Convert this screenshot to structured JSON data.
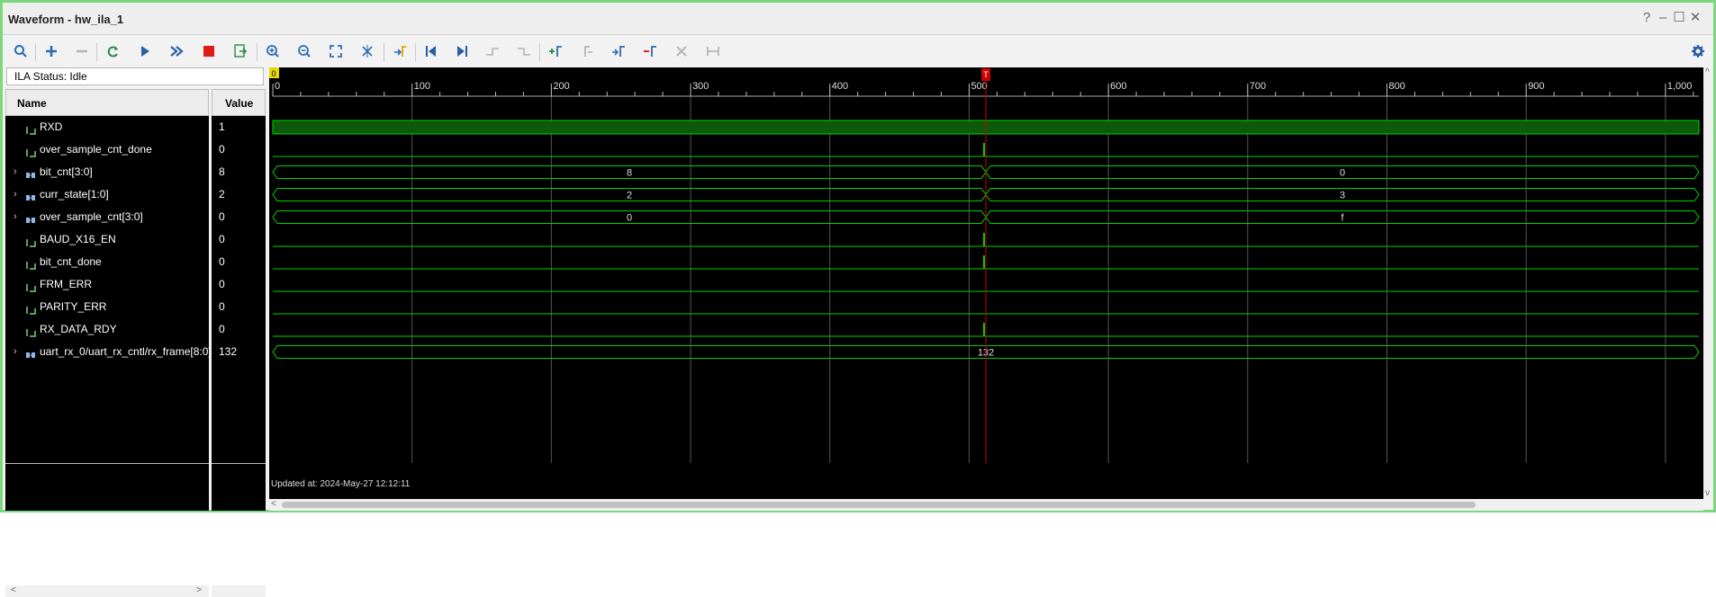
{
  "window": {
    "title": "Waveform - hw_ila_1",
    "controls": [
      "?",
      "–",
      "☐",
      "✕"
    ]
  },
  "toolbar": {
    "buttons": [
      "search-icon",
      "add-icon",
      "remove-icon",
      "refresh-icon",
      "run-trigger-icon",
      "run-immediate-icon",
      "stop-icon",
      "export-icon",
      "zoom-in-icon",
      "zoom-out-icon",
      "zoom-fit-icon",
      "cursor-icon",
      "goto-marker-icon",
      "goto-first-icon",
      "goto-last-icon",
      "prev-transition-icon",
      "next-transition-icon",
      "add-marker-icon",
      "prev-marker-icon",
      "next-marker-icon",
      "swap-cursor-icon",
      "delete-icon",
      "group-icon"
    ],
    "settings": "gear-icon"
  },
  "status": {
    "text": "ILA Status:  Idle"
  },
  "columns": {
    "name": "Name",
    "value": "Value"
  },
  "signals": [
    {
      "name": "RXD",
      "value": "1",
      "kind": "bit",
      "expandable": false
    },
    {
      "name": "over_sample_cnt_done",
      "value": "0",
      "kind": "bit",
      "expandable": false
    },
    {
      "name": "bit_cnt[3:0]",
      "value": "8",
      "kind": "bus",
      "expandable": true
    },
    {
      "name": "curr_state[1:0]",
      "value": "2",
      "kind": "bus",
      "expandable": true
    },
    {
      "name": "over_sample_cnt[3:0]",
      "value": "0",
      "kind": "bus",
      "expandable": true
    },
    {
      "name": "BAUD_X16_EN",
      "value": "0",
      "kind": "bit",
      "expandable": false
    },
    {
      "name": "bit_cnt_done",
      "value": "0",
      "kind": "bit",
      "expandable": false
    },
    {
      "name": "FRM_ERR",
      "value": "0",
      "kind": "bit",
      "expandable": false
    },
    {
      "name": "PARITY_ERR",
      "value": "0",
      "kind": "bit",
      "expandable": false
    },
    {
      "name": "RX_DATA_RDY",
      "value": "0",
      "kind": "bit",
      "expandable": false
    },
    {
      "name": "uart_rx_0/uart_rx_cntl/rx_frame[8:0]",
      "value": "132",
      "kind": "bus",
      "expandable": true
    }
  ],
  "waveform": {
    "origin_marker": "0",
    "trigger_marker": "T",
    "trigger_sample": 512,
    "sample_range": [
      0,
      1024
    ],
    "ticks": [
      "0",
      "100",
      "200",
      "300",
      "400",
      "500",
      "600",
      "700",
      "800",
      "900",
      "1,000"
    ],
    "updated_text": "Updated at: 2024-May-27 12:12:11",
    "bus_values": {
      "bit_cnt[3:0]": [
        "8",
        "0"
      ],
      "curr_state[1:0]": [
        "2",
        "3"
      ],
      "over_sample_cnt[3:0]": [
        "0",
        "f"
      ],
      "uart_rx_0/uart_rx_cntl/rx_frame[8:0]": [
        "132"
      ]
    },
    "colors": {
      "wave": "#00d000",
      "high_fill": "#0a5a0a",
      "trigger": "#cc0000",
      "grid": "#555555"
    }
  }
}
